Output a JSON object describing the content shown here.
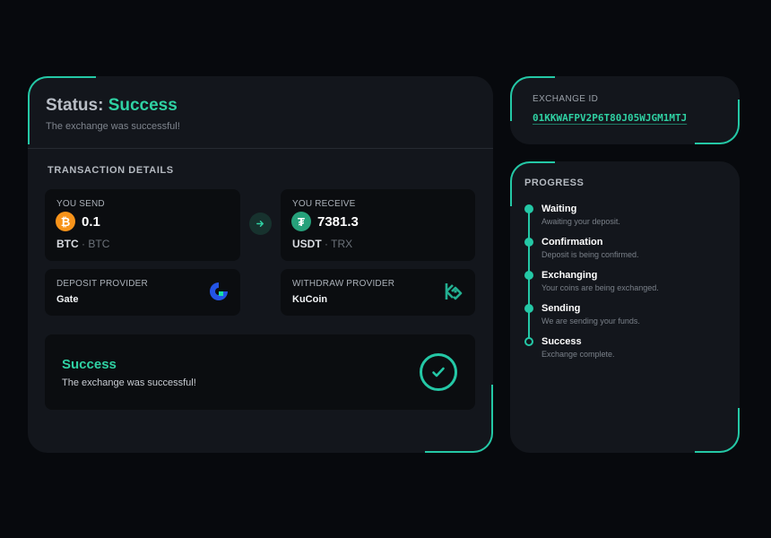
{
  "status": {
    "prefix": "Status:",
    "value": "Success",
    "subtitle": "The exchange was successful!"
  },
  "details": {
    "section_label": "TRANSACTION DETAILS",
    "send": {
      "label": "YOU SEND",
      "amount": "0.1",
      "symbol": "BTC",
      "separator": "·",
      "network": "BTC",
      "icon": "bitcoin-icon",
      "icon_color": "#f7931a",
      "glyph": "₿"
    },
    "receive": {
      "label": "YOU RECEIVE",
      "amount": "7381.3",
      "symbol": "USDT",
      "separator": "·",
      "network": "TRX",
      "icon": "tether-icon",
      "icon_color": "#26a17b",
      "glyph": "₮"
    },
    "deposit_provider": {
      "label": "DEPOSIT PROVIDER",
      "name": "Gate",
      "icon": "gate-logo-icon"
    },
    "withdraw_provider": {
      "label": "WITHDRAW PROVIDER",
      "name": "KuCoin",
      "icon": "kucoin-logo-icon"
    }
  },
  "success_banner": {
    "title": "Success",
    "message": "The exchange was successful!",
    "icon": "check-circle-icon"
  },
  "exchange": {
    "label": "EXCHANGE ID",
    "id": "01KKWAFPV2P6T80J05WJGM1MTJ"
  },
  "progress": {
    "label": "PROGRESS",
    "steps": [
      {
        "title": "Waiting",
        "desc": "Awaiting your deposit.",
        "state": "done"
      },
      {
        "title": "Confirmation",
        "desc": "Deposit is being confirmed.",
        "state": "done"
      },
      {
        "title": "Exchanging",
        "desc": "Your coins are being exchanged.",
        "state": "done"
      },
      {
        "title": "Sending",
        "desc": "We are sending your funds.",
        "state": "done"
      },
      {
        "title": "Success",
        "desc": "Exchange complete.",
        "state": "current"
      }
    ]
  },
  "colors": {
    "accent": "#24c8a6",
    "success_text": "#2fd1a3",
    "background": "#07090d",
    "card": "#13161c"
  }
}
